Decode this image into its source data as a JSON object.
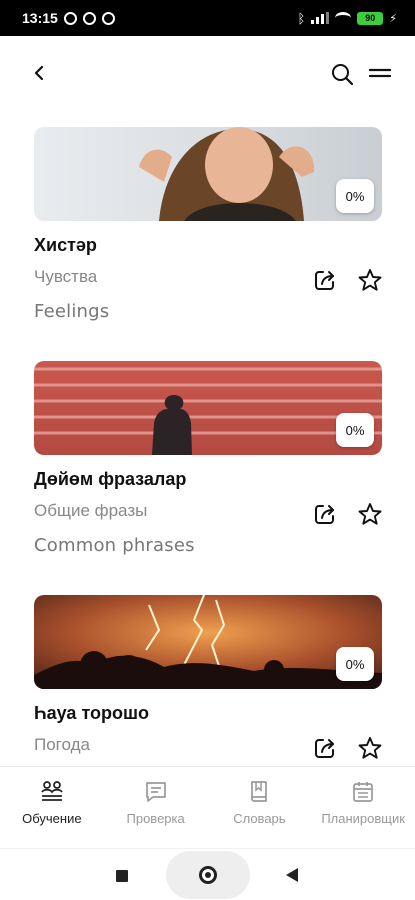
{
  "status_bar": {
    "time": "13:15",
    "battery": "90"
  },
  "header": {
    "back_icon": "chevron-left-icon",
    "search_icon": "search-icon",
    "menu_icon": "menu-icon"
  },
  "cards": [
    {
      "title": "Хистәр",
      "subtitle": "Чувства",
      "english": "Feelings",
      "progress": "0%"
    },
    {
      "title": "Дөйөм фразалар",
      "subtitle": "Общие фразы",
      "english": "Common phrases",
      "progress": "0%"
    },
    {
      "title": "Һауа торошо",
      "subtitle": "Погода",
      "english": "",
      "progress": "0%"
    }
  ],
  "bottom_nav": [
    {
      "label": "Обучение",
      "icon": "learning-icon",
      "active": true
    },
    {
      "label": "Проверка",
      "icon": "chat-check-icon",
      "active": false
    },
    {
      "label": "Словарь",
      "icon": "book-icon",
      "active": false
    },
    {
      "label": "Планировщик",
      "icon": "calendar-icon",
      "active": false
    }
  ],
  "colors": {
    "accent_text": "#111111",
    "muted_text": "#888888",
    "battery_green": "#3ccf3c"
  }
}
